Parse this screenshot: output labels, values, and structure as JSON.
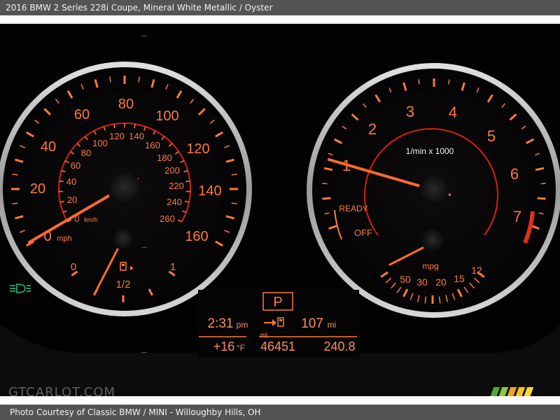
{
  "header": {
    "title": "2016 BMW 2 Series 228i Coupe,  Mineral White Metallic / Oyster"
  },
  "speedometer": {
    "mph_labels": [
      "0",
      "20",
      "40",
      "60",
      "80",
      "100",
      "120",
      "140",
      "160"
    ],
    "mph_unit": "mph",
    "kmh_labels": [
      "0",
      "20",
      "40",
      "60",
      "80",
      "100",
      "120",
      "140",
      "160",
      "180",
      "200",
      "220",
      "240",
      "260"
    ],
    "kmh_unit": "km/h"
  },
  "fuel_gauge": {
    "empty_label": "0",
    "half_label": "1/2",
    "full_label": "1"
  },
  "tachometer": {
    "rpm_labels": [
      "1",
      "2",
      "3",
      "4",
      "5",
      "6",
      "7"
    ],
    "unit_label": "1/min x 1000",
    "ready_label": "READY",
    "off_label": "OFF"
  },
  "mpg_gauge": {
    "unit_label": "mpg",
    "labels": [
      "50",
      "30",
      "20",
      "15",
      "12"
    ]
  },
  "info_display": {
    "gear": "P",
    "time": "2:31",
    "time_suffix": "pm",
    "range_value": "107",
    "range_unit": "mi",
    "temperature": "+16",
    "temp_unit": "°F",
    "odometer_unit": "mi",
    "odometer": "46451",
    "trip": "240.8"
  },
  "watermark": "GTCARLOT.COM",
  "footer": {
    "credit": "Photo Courtesy of Classic BMW / MINI - Willoughby Hills, OH"
  },
  "colors": {
    "orange": "#ff7a3c",
    "red_ring": "#d81e12",
    "chrome": "#bdbdbd",
    "headlight_green": "#29c27e"
  }
}
